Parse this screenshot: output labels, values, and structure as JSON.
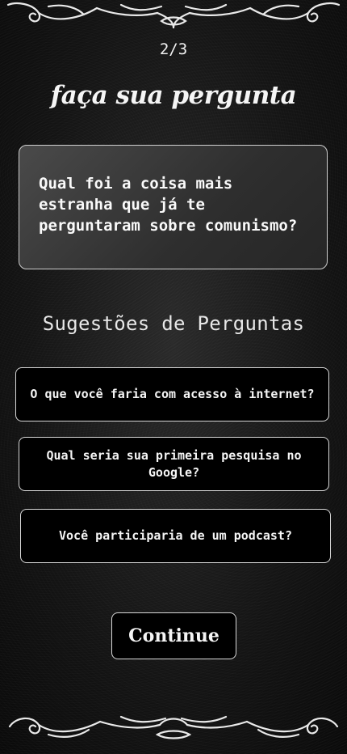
{
  "header": {
    "step_indicator": "2/3",
    "title": "faça sua pergunta"
  },
  "question": {
    "text": "Qual foi a coisa mais estranha que já te perguntaram sobre comunismo?"
  },
  "suggestions": {
    "heading": "Sugestões de Perguntas",
    "items": [
      {
        "label": "O que você faria com acesso à internet?"
      },
      {
        "label": "Qual seria sua primeira pesquisa no Google?"
      },
      {
        "label": "Você participaria de um podcast?"
      }
    ]
  },
  "actions": {
    "continue_label": "Continue"
  },
  "colors": {
    "background": "#141414",
    "border": "#d8d8d8",
    "text": "#ffffff"
  }
}
